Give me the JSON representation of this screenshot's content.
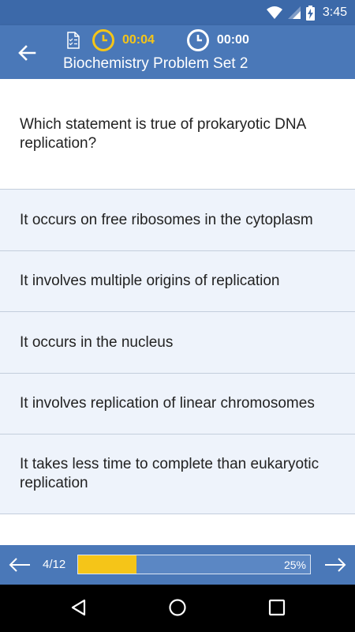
{
  "status_bar": {
    "time": "3:45"
  },
  "header": {
    "title": "Biochemistry Problem Set 2",
    "question_timer": "00:04",
    "total_timer": "00:00"
  },
  "question": {
    "text": "Which statement is true of prokaryotic DNA replication?"
  },
  "answers": [
    {
      "text": "It occurs on free ribosomes in the cytoplasm"
    },
    {
      "text": "It involves multiple origins of replication"
    },
    {
      "text": "It occurs in the nucleus"
    },
    {
      "text": "It involves replication of linear chromosomes"
    },
    {
      "text": "It takes less time to complete than eukaryotic replication"
    }
  ],
  "progress": {
    "counter": "4/12",
    "percent_label": "25%",
    "fraction": 0.25
  },
  "colors": {
    "header_blue": "#4a78b8",
    "accent_yellow": "#f5c518",
    "answer_bg": "#eef3fb"
  }
}
